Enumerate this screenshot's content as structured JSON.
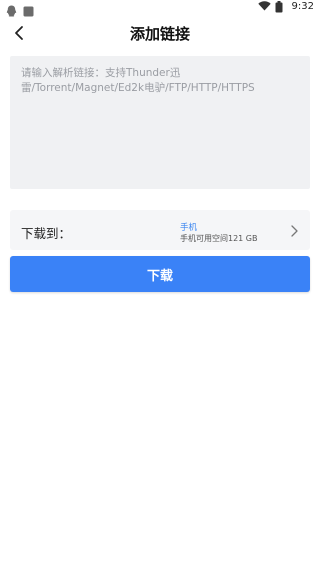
{
  "status_bar": {
    "time": "9:32"
  },
  "header": {
    "title": "添加链接"
  },
  "link_input": {
    "value": "",
    "placeholder": "请输入解析链接：支持Thunder迅雷/Torrent/Magnet/Ed2k电驴/FTP/HTTP/HTTPS"
  },
  "download_location": {
    "label": "下载到：",
    "device": "手机",
    "space": "手机可用空间121 GB"
  },
  "download_button": {
    "label": "下载"
  },
  "colors": {
    "accent": "#3a82f7",
    "input_bg": "#f0f1f3",
    "row_bg": "#f5f6f8"
  }
}
